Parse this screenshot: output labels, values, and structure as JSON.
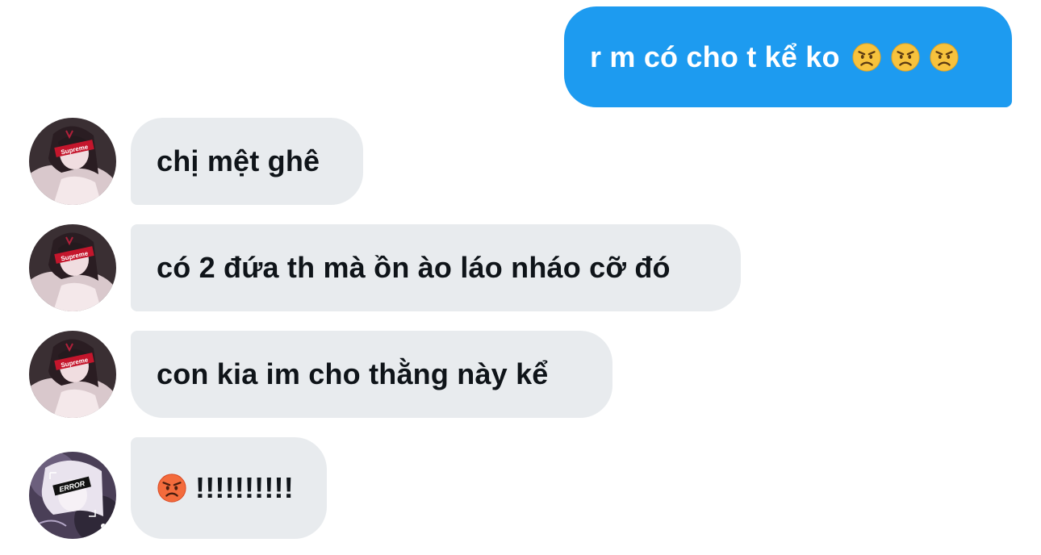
{
  "conversation": {
    "outgoing": [
      {
        "text": "r m có cho t kể ko",
        "emojis": [
          "angry-face-icon",
          "angry-face-icon",
          "angry-face-icon"
        ]
      }
    ],
    "incoming": [
      {
        "text": "chị mệt ghê",
        "avatar": "supreme-girl-avatar"
      },
      {
        "text": "có 2 đứa th mà ồn ào láo nháo cỡ đó",
        "avatar": "supreme-girl-avatar"
      },
      {
        "text": "con kia im cho thằng này kể",
        "avatar": "supreme-girl-avatar"
      },
      {
        "text": "!!!!!!!!!!",
        "emoji": "pouting-face-icon",
        "avatar": "error-girl-avatar"
      }
    ],
    "avatar_labels": {
      "supreme": "Supreme",
      "error": "ERROR"
    }
  },
  "colors": {
    "outgoing_bubble": "#1d9bf0",
    "incoming_bubble": "#e8ebee",
    "incoming_text": "#0f1419",
    "outgoing_text": "#ffffff"
  }
}
